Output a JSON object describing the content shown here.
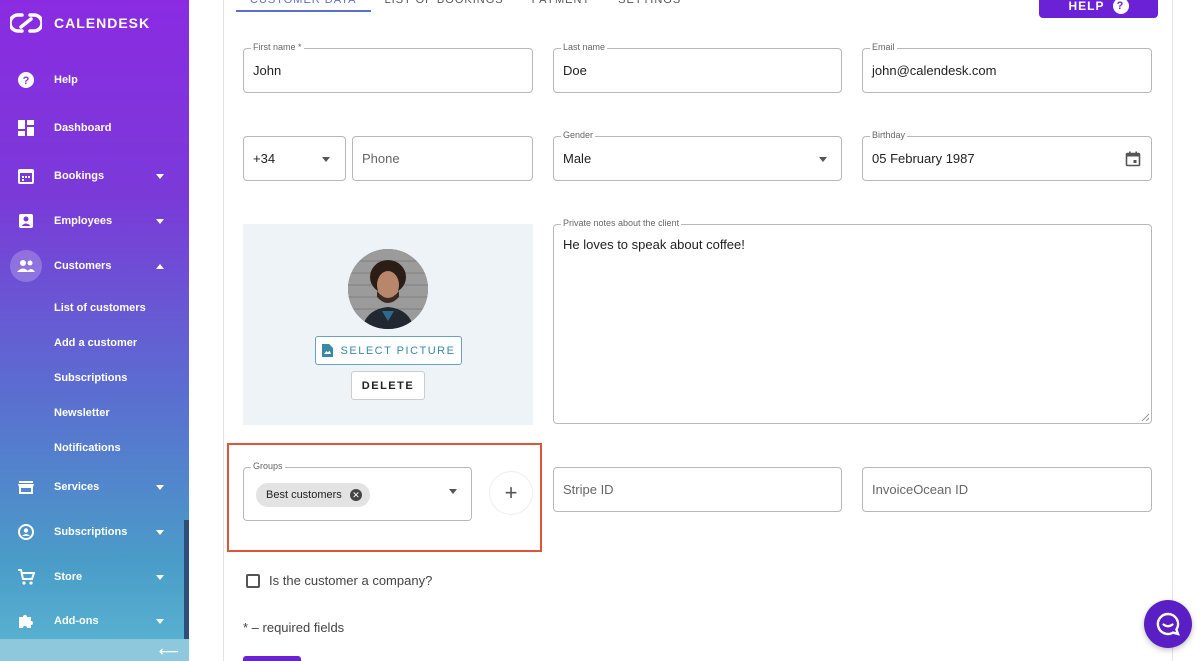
{
  "app": {
    "logo_text": "CALENDESK"
  },
  "sidebar": {
    "items": [
      {
        "label": "Help",
        "icon": "help-circle-icon"
      },
      {
        "label": "Dashboard",
        "icon": "dashboard-icon"
      },
      {
        "label": "Bookings",
        "icon": "calendar-icon"
      },
      {
        "label": "Employees",
        "icon": "employee-badge-icon"
      },
      {
        "label": "Customers",
        "icon": "people-icon"
      },
      {
        "label": "Services",
        "icon": "store-icon"
      },
      {
        "label": "Subscriptions",
        "icon": "subscription-icon"
      },
      {
        "label": "Store",
        "icon": "cart-icon"
      },
      {
        "label": "Add-ons",
        "icon": "puzzle-icon"
      }
    ],
    "customers_sub": [
      "List of customers",
      "Add a customer",
      "Subscriptions",
      "Newsletter",
      "Notifications"
    ]
  },
  "tabs": [
    {
      "label": "CUSTOMER DATA"
    },
    {
      "label": "LIST OF BOOKINGS"
    },
    {
      "label": "PAYMENT"
    },
    {
      "label": "SETTINGS"
    }
  ],
  "help_button": {
    "label": "HELP",
    "icon_glyph": "?"
  },
  "form": {
    "first_name": {
      "label": "First name *",
      "value": "John"
    },
    "last_name": {
      "label": "Last name",
      "value": "Doe"
    },
    "email": {
      "label": "Email",
      "value": "john@calendesk.com"
    },
    "phone_prefix": {
      "value": "+34"
    },
    "phone": {
      "placeholder": "Phone"
    },
    "gender": {
      "label": "Gender",
      "value": "Male"
    },
    "birthday": {
      "label": "Birthday",
      "value": "05 February 1987"
    },
    "notes": {
      "label": "Private notes about the client",
      "value": "He loves to speak about coffee!"
    },
    "select_picture": "SELECT PICTURE",
    "delete": "DELETE",
    "groups": {
      "label": "Groups",
      "chip": "Best customers",
      "add_glyph": "+"
    },
    "stripe_id": {
      "placeholder": "Stripe ID"
    },
    "invoiceocean_id": {
      "placeholder": "InvoiceOcean ID"
    },
    "company_checkbox": "Is the customer a company?",
    "required_note": "* – required fields"
  },
  "colors": {
    "accent": "#6b22d6",
    "highlight": "#e0553a",
    "link": "#3a88a8"
  }
}
